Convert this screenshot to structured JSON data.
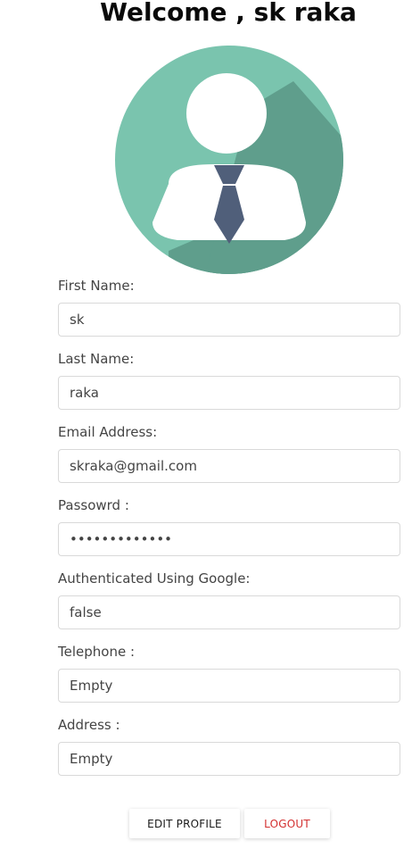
{
  "header": {
    "title": "Welcome , sk raka"
  },
  "avatar": {
    "icon": "user-avatar-icon",
    "colors": {
      "circle": "#7ac4ae",
      "shadow": "#5f9e8c",
      "head": "#ffffff",
      "body": "#ffffff",
      "tie": "#505f7a"
    }
  },
  "form": {
    "fields": [
      {
        "label": "First Name:",
        "value": "sk",
        "type": "text"
      },
      {
        "label": "Last Name:",
        "value": "raka",
        "type": "text"
      },
      {
        "label": "Email Address:",
        "value": "skraka@gmail.com",
        "type": "text"
      },
      {
        "label": "Passowrd :",
        "value": "•••••••••••••",
        "type": "text"
      },
      {
        "label": "Authenticated Using Google:",
        "value": "false",
        "type": "text"
      },
      {
        "label": "Telephone :",
        "value": "Empty",
        "type": "text"
      },
      {
        "label": "Address :",
        "value": "Empty",
        "type": "text"
      }
    ]
  },
  "actions": {
    "edit_label": "EDIT PROFILE",
    "logout_label": "LOGOUT",
    "logout_color": "#d32f2f"
  }
}
